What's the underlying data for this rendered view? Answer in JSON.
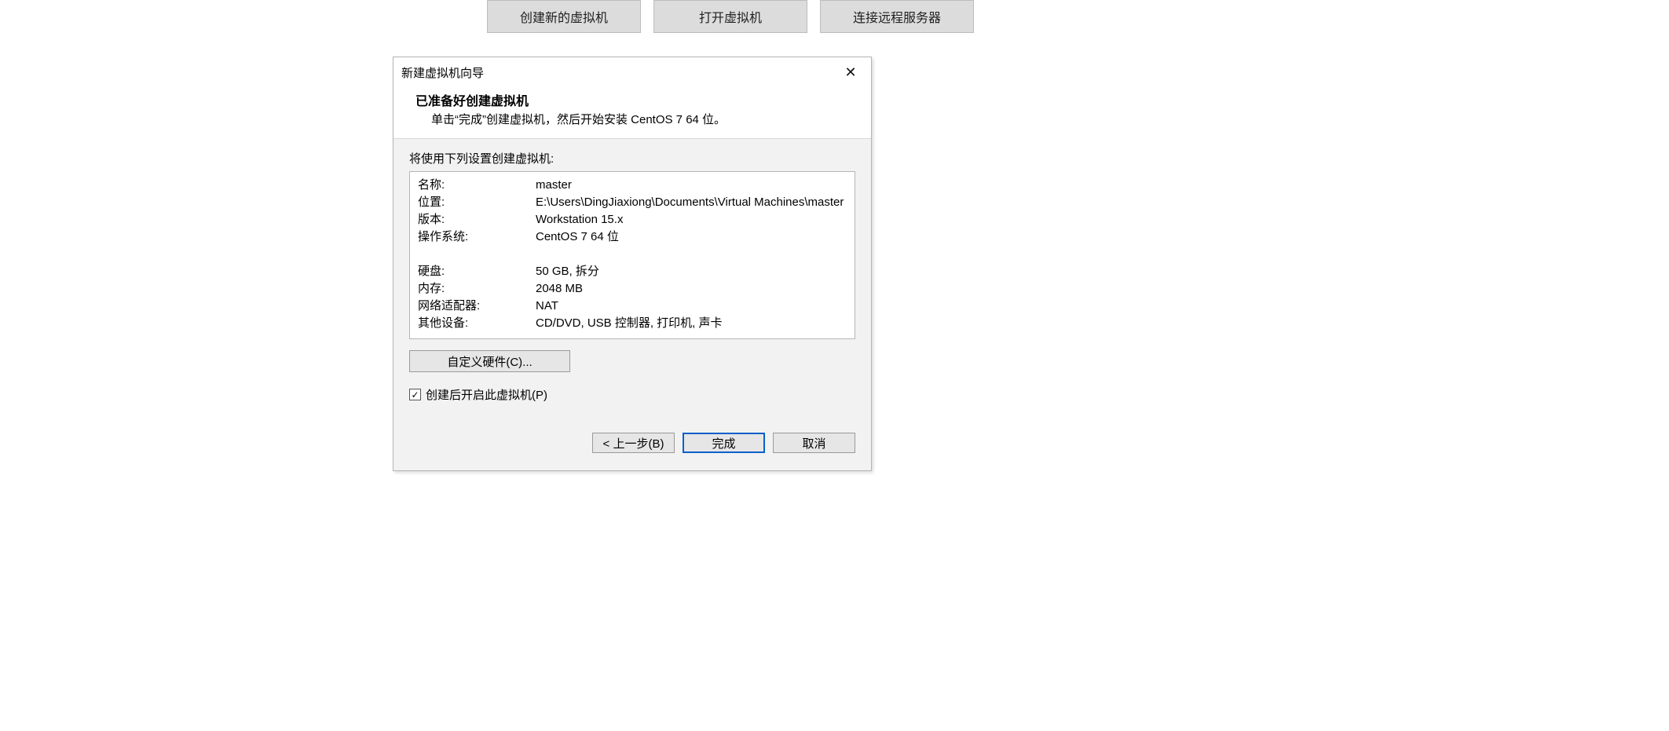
{
  "bg_buttons": {
    "create": "创建新的虚拟机",
    "open": "打开虚拟机",
    "connect": "连接远程服务器"
  },
  "titlebar": {
    "title": "新建虚拟机向导"
  },
  "header": {
    "title": "已准备好创建虚拟机",
    "sub": "单击“完成”创建虚拟机，然后开始安装 CentOS 7 64 位。"
  },
  "body": {
    "label": "将使用下列设置创建虚拟机:"
  },
  "summary": {
    "name_k": "名称:",
    "name_v": "master",
    "loc_k": "位置:",
    "loc_v": "E:\\Users\\DingJiaxiong\\Documents\\Virtual Machines\\master",
    "ver_k": "版本:",
    "ver_v": "Workstation 15.x",
    "os_k": "操作系统:",
    "os_v": "CentOS 7 64 位",
    "disk_k": "硬盘:",
    "disk_v": "50 GB, 拆分",
    "mem_k": "内存:",
    "mem_v": "2048 MB",
    "net_k": "网络适配器:",
    "net_v": "NAT",
    "other_k": "其他设备:",
    "other_v": "CD/DVD, USB 控制器, 打印机, 声卡"
  },
  "custom_btn": "自定义硬件(C)...",
  "checkbox": {
    "checked": true,
    "label": "创建后开启此虚拟机(P)"
  },
  "footer": {
    "back": "< 上一步(B)",
    "finish": "完成",
    "cancel": "取消"
  }
}
